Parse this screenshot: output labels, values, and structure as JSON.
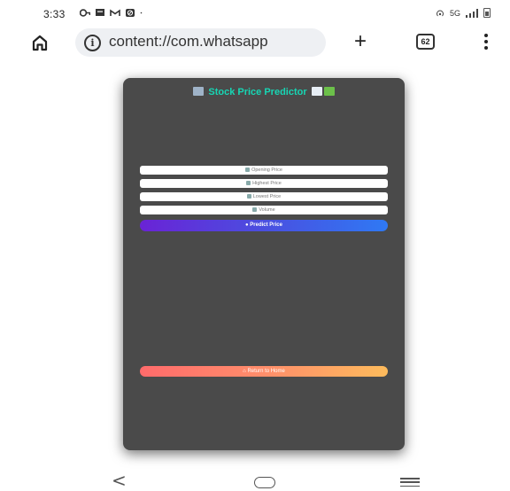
{
  "status_bar": {
    "time": "3:33",
    "left_icons": [
      "vpn-key-icon",
      "message-icon",
      "gmail-icon",
      "blocked-icon",
      "dot-icon"
    ],
    "network": "5G",
    "icons_right": [
      "hotspot-icon",
      "signal-icon",
      "battery-icon"
    ]
  },
  "browser": {
    "url": "content://com.whatsapp",
    "tab_count": "62"
  },
  "app": {
    "title": "Stock Price Predictor",
    "fields": [
      {
        "placeholder": "Opening Price",
        "icon": "bank-icon"
      },
      {
        "placeholder": "Highest Price",
        "icon": "chart-up-icon"
      },
      {
        "placeholder": "Lowest Price",
        "icon": "chart-down-icon"
      },
      {
        "placeholder": "Volume",
        "icon": "bar-chart-icon"
      }
    ],
    "predict_label": "Predict Price",
    "return_label": "Return to Home",
    "colors": {
      "background": "#4a4a4a",
      "title": "#17d6b4",
      "predict_gradient": [
        "#6a23d6",
        "#2f79f4"
      ],
      "return_gradient": [
        "#ff6b6b",
        "#fdbb5c"
      ]
    }
  }
}
